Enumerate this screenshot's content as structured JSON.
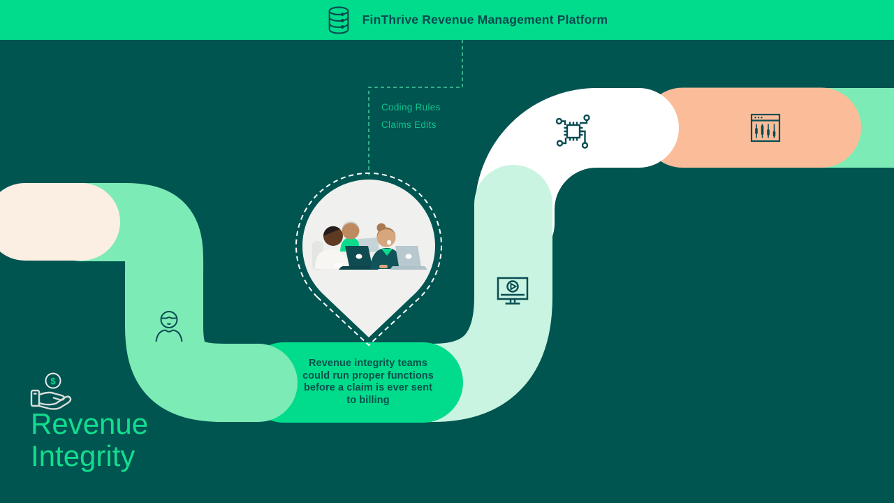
{
  "header": {
    "title": "FinThrive Revenue Management Platform"
  },
  "callout": {
    "items": [
      "Coding Rules",
      "Claims Edits"
    ]
  },
  "journey_note": {
    "lines": [
      "Revenue integrity teams",
      "could run proper functions",
      "before a claim is ever sent",
      "to billing"
    ]
  },
  "section": {
    "title": "Revenue\nIntegrity",
    "coin_symbol": "$"
  },
  "icons": [
    "database-icon",
    "chip-icon",
    "sliders-window-icon",
    "video-monitor-icon",
    "person-icon",
    "hand-coin-icon",
    "team-illustration",
    "location-pin"
  ],
  "colors": {
    "header_green": "#00DC8C",
    "background_teal": "#005551",
    "ribbon_green": "#7DEBB5",
    "ribbon_mint": "#C8F4E1",
    "ribbon_peach": "#FBBD99",
    "ribbon_cream": "#FBEEE2",
    "ribbon_white": "#FFFFFF",
    "pin_fill": "#F0F0EE",
    "dark_teal_ink": "#094C53",
    "label_green": "#0FC28D",
    "title_green": "#12DD8E"
  }
}
